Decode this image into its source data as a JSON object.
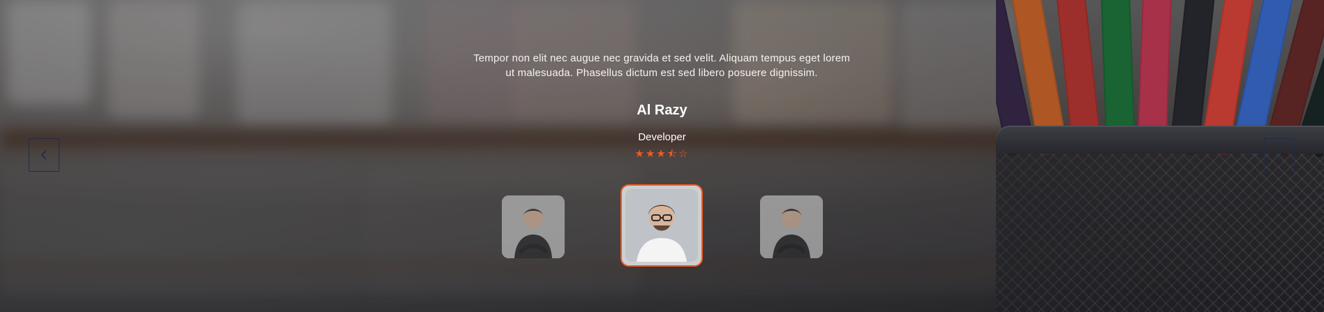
{
  "testimonial": {
    "quote": "Tempor non elit nec augue nec gravida et sed velit. Aliquam tempus eget lorem ut malesuada. Phasellus dictum est sed libero posuere dignissim.",
    "name": "Al Razy",
    "role": "Developer",
    "rating": 3.5,
    "rating_stars": "★★★⯪☆"
  },
  "navigation": {
    "prev_icon": "chevron-left-icon",
    "next_icon": "chevron-right-icon"
  },
  "thumbnails": {
    "left_avatar": "woman-avatar",
    "center_avatar": "man-with-glasses-avatar",
    "right_avatar": "woman-avatar"
  },
  "colors": {
    "accent": "#f15a24",
    "nav": "#222b46",
    "text": "#ffffff"
  }
}
